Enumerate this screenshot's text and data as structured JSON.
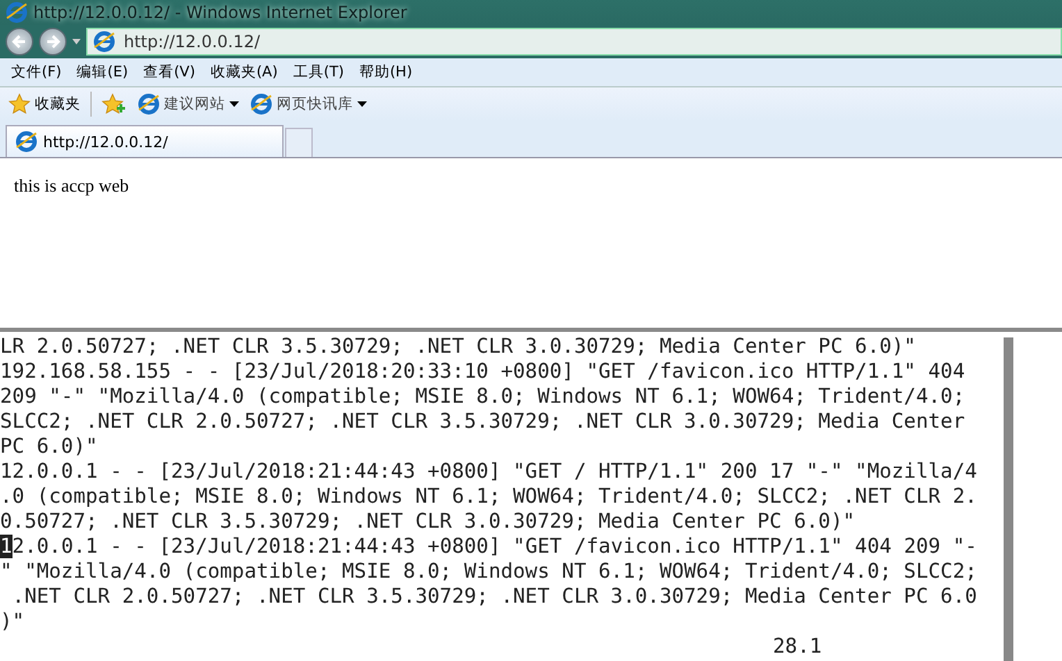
{
  "browser": {
    "title": "http://12.0.0.12/ - Windows Internet Explorer",
    "address": "http://12.0.0.12/",
    "menu": [
      "文件(F)",
      "编辑(E)",
      "查看(V)",
      "收藏夹(A)",
      "工具(T)",
      "帮助(H)"
    ],
    "favorites": "收藏夹",
    "links": [
      {
        "label": "建议网站"
      },
      {
        "label": "网页快讯库"
      }
    ],
    "tabs": [
      {
        "label": "http://12.0.0.12/",
        "selected": true
      }
    ],
    "page_text": "this is accp web"
  },
  "terminal": {
    "lines": [
      {
        "text": "LR 2.0.50727; .NET CLR 3.5.30729; .NET CLR 3.0.30729; Media Center PC 6.0)\"",
        "cursor": false
      },
      {
        "text": "192.168.58.155 - - [23/Jul/2018:20:33:10 +0800] \"GET /favicon.ico HTTP/1.1\" 404",
        "cursor": false
      },
      {
        "text": "209 \"-\" \"Mozilla/4.0 (compatible; MSIE 8.0; Windows NT 6.1; WOW64; Trident/4.0;",
        "cursor": false
      },
      {
        "text": "SLCC2; .NET CLR 2.0.50727; .NET CLR 3.5.30729; .NET CLR 3.0.30729; Media Center",
        "cursor": false
      },
      {
        "text": "PC 6.0)\"",
        "cursor": false
      },
      {
        "text": "12.0.0.1 - - [23/Jul/2018:21:44:43 +0800] \"GET / HTTP/1.1\" 200 17 \"-\" \"Mozilla/4",
        "cursor": false
      },
      {
        "text": ".0 (compatible; MSIE 8.0; Windows NT 6.1; WOW64; Trident/4.0; SLCC2; .NET CLR 2.",
        "cursor": false
      },
      {
        "text": "0.50727; .NET CLR 3.5.30729; .NET CLR 3.0.30729; Media Center PC 6.0)\"",
        "cursor": false
      },
      {
        "text": "12.0.0.1 - - [23/Jul/2018:21:44:43 +0800] \"GET /favicon.ico HTTP/1.1\" 404 209 \"-",
        "cursor": true
      },
      {
        "text": "\" \"Mozilla/4.0 (compatible; MSIE 8.0; Windows NT 6.1; WOW64; Trident/4.0; SLCC2;",
        "cursor": false
      },
      {
        "text": " .NET CLR 2.0.50727; .NET CLR 3.5.30729; .NET CLR 3.0.30729; Media Center PC 6.0",
        "cursor": false
      },
      {
        "text": ")\"",
        "cursor": false
      }
    ],
    "status": "28.1"
  }
}
